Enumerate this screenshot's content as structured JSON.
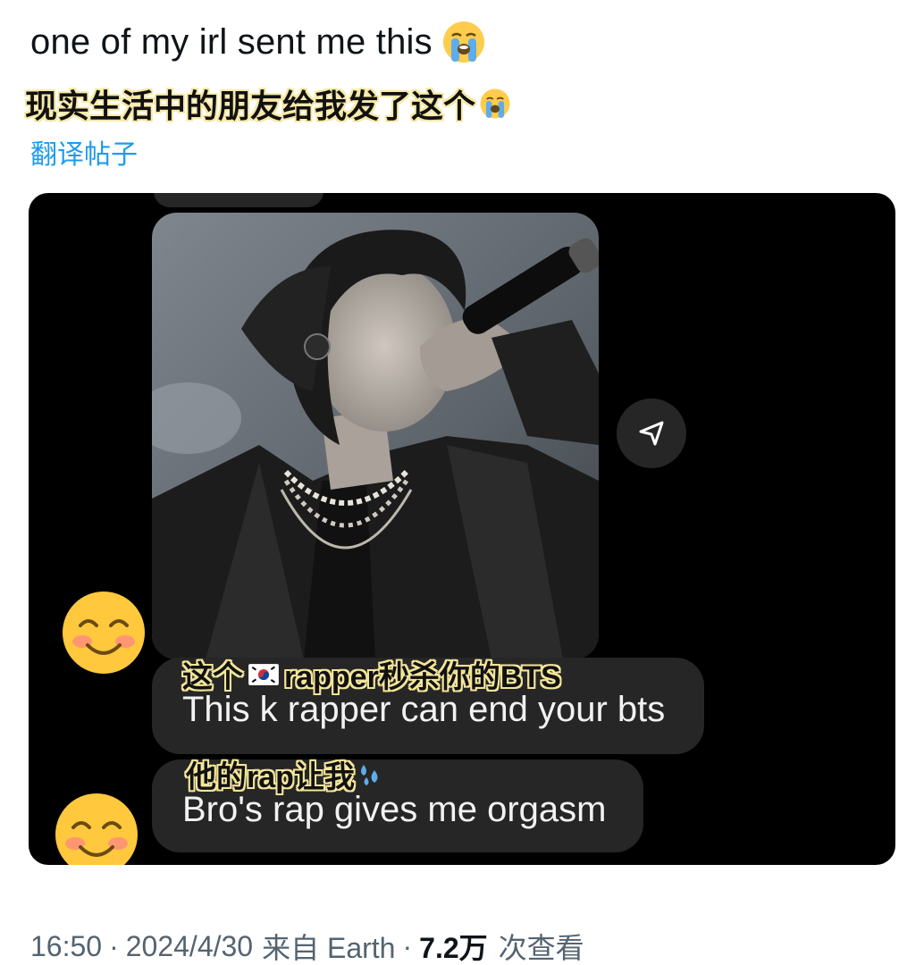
{
  "post": {
    "text": "one of my irl sent me this",
    "text_emoji": "loudly-crying-face-emoji",
    "caption_cn": "现实生活中的朋友给我发了这个",
    "translate_label": "翻译帖子"
  },
  "media": {
    "photo_alt": "concert-photo-rapper",
    "message1": {
      "caption_cn_prefix": "这个",
      "caption_flag": "south-korea-flag-emoji",
      "caption_cn_suffix": "rapper秒杀你的BTS",
      "text": "This k rapper can end your bts"
    },
    "message2": {
      "caption_cn": "他的rap让我",
      "caption_emoji": "sweat-droplets-emoji",
      "text": "Bro's rap gives me orgasm"
    },
    "avatar_emoji": "smiling-face-emoji",
    "share_icon": "send-arrow-icon"
  },
  "meta": {
    "time": "16:50",
    "separator": "·",
    "date": "2024/4/30",
    "source": "来自 Earth",
    "views_count": "7.2万",
    "views_label": "次查看"
  },
  "colors": {
    "link": "#1d9bf0",
    "bubble": "#262626",
    "meta": "#536471",
    "caption_outline": "#f7e9a8"
  }
}
